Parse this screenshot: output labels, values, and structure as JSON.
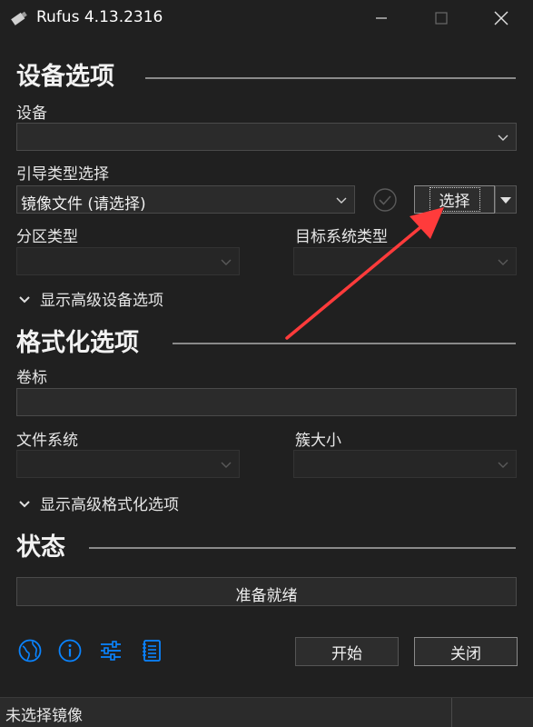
{
  "window": {
    "title": "Rufus 4.13.2316"
  },
  "device_options": {
    "section_title": "设备选项",
    "device_label": "设备",
    "device_value": "",
    "boot_selection_label": "引导类型选择",
    "boot_selection_value": "镜像文件 (请选择)",
    "select_button_label": "选择",
    "partition_scheme_label": "分区类型",
    "partition_scheme_value": "",
    "target_system_label": "目标系统类型",
    "target_system_value": "",
    "advanced_toggle_label": "显示高级设备选项"
  },
  "format_options": {
    "section_title": "格式化选项",
    "volume_label_label": "卷标",
    "volume_label_value": "",
    "file_system_label": "文件系统",
    "file_system_value": "",
    "cluster_size_label": "簇大小",
    "cluster_size_value": "",
    "advanced_toggle_label": "显示高级格式化选项"
  },
  "status": {
    "section_title": "状态",
    "progress_text": "准备就绪",
    "progress_fraction": 0
  },
  "toolbar": {
    "icons": [
      "globe-icon",
      "info-icon",
      "settings-sliders-icon",
      "log-icon"
    ],
    "start_label": "开始",
    "close_label": "关闭"
  },
  "statusbar": {
    "text": "未选择镜像"
  },
  "colors": {
    "accent": "#0a84ff",
    "annotation_arrow": "#ff3b3b",
    "background": "#202020"
  }
}
